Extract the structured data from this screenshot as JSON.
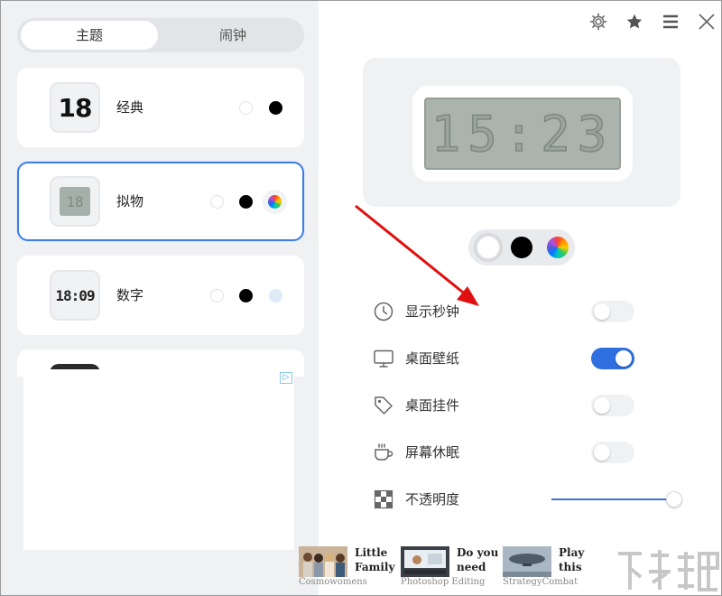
{
  "tabs": {
    "theme": "主题",
    "alarm": "闹钟"
  },
  "themes": [
    {
      "icon_text": "18",
      "label": "经典",
      "colors": [
        "white",
        "black"
      ]
    },
    {
      "icon_text": "18",
      "label": "拟物",
      "colors": [
        "white",
        "black",
        "rainbow"
      ]
    },
    {
      "icon_text": "18:09",
      "label": "数字",
      "colors": [
        "white",
        "black",
        "light-blue"
      ]
    }
  ],
  "selected_theme": "拟物",
  "preview": {
    "time": "15:23"
  },
  "colors": {
    "accent": "#2f6fe0",
    "selection_border": "#3d7ee6"
  },
  "settings": [
    {
      "icon": "clock-icon",
      "label": "显示秒钟",
      "on": false
    },
    {
      "icon": "monitor-icon",
      "label": "桌面壁纸",
      "on": true
    },
    {
      "icon": "tag-icon",
      "label": "桌面挂件",
      "on": false
    },
    {
      "icon": "coffee-cup-icon",
      "label": "屏幕休眠",
      "on": false
    },
    {
      "icon": "checkerboard-icon",
      "label": "不透明度",
      "slider_value": 1.0
    }
  ],
  "ads": [
    {
      "title": "Little Family",
      "source": "Cosmowomens"
    },
    {
      "title": "Do you need",
      "source": "Photoshop Editing"
    },
    {
      "title": "Play this",
      "source": "StrategyCombat"
    }
  ],
  "ad_choices_label": "▷"
}
